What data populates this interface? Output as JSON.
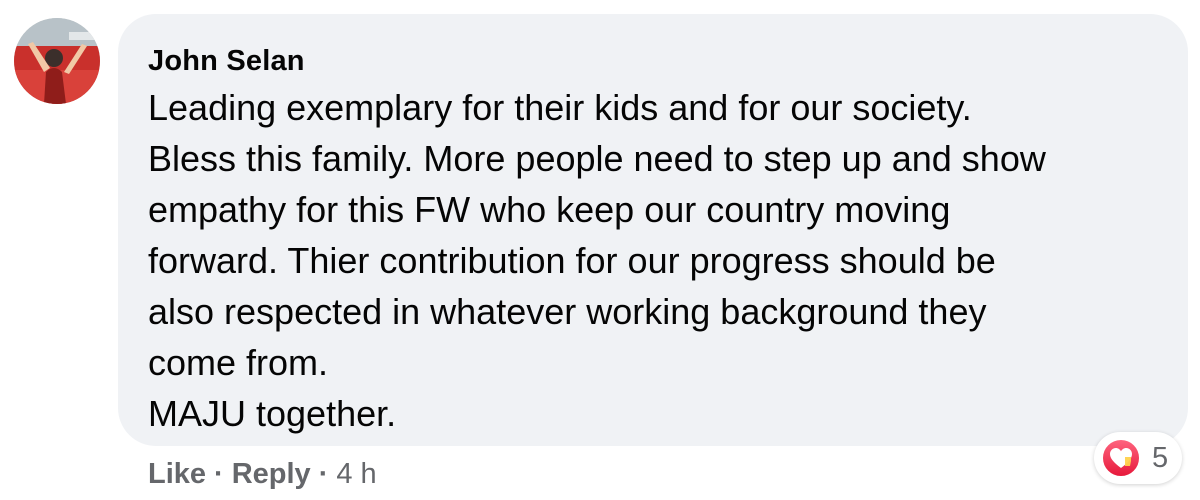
{
  "comment": {
    "author": "John Selan",
    "text": "Leading exemplary for their kids and for our society.\nBless this family. More people need to step up and show\nempathy for this FW who keep our country moving\nforward. Thier contribution for our progress should be\nalso respected in whatever working background they\ncome from.\nMAJU together."
  },
  "actions": {
    "like_label": "Like",
    "separator": "·",
    "reply_label": "Reply",
    "time": "4 h"
  },
  "reactions": {
    "icon": "love-reaction-icon",
    "count": "5"
  },
  "colors": {
    "bubble": "#f0f2f5",
    "text": "#050505",
    "secondary": "#65676b",
    "love": "#f33e58"
  }
}
